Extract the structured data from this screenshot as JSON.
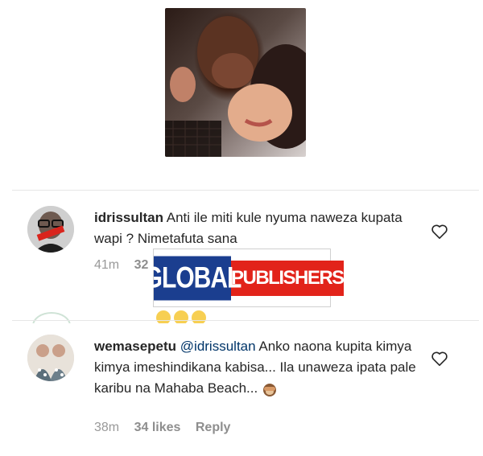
{
  "post": {
    "image": "post-photo-couple"
  },
  "comments": [
    {
      "username": "idrissultan",
      "text": "Anti ile miti kule nyuma naweza kupata wapi ? Nimetafuta sana",
      "time": "41m",
      "likes": "32",
      "avatar_badge": "ORDERED"
    },
    {
      "username": "wemasepetu",
      "mention": "@idrissultan",
      "text": "Anko naona kupita kimya kimya imeshindikana kabisa... Ila unaweza ipata pale karibu na Mahaba Beach...",
      "time": "38m",
      "likes": "34 likes",
      "reply": "Reply"
    }
  ],
  "watermark": {
    "left": "GLOBAL",
    "right": "PUBLISHERS"
  },
  "icons": [
    "heart-icon",
    "monkey-emoji-icon"
  ],
  "colors": {
    "text": "#262626",
    "meta": "#999999",
    "mention": "#003569",
    "watermark_blue": "#1b3e8f",
    "watermark_red": "#e2231a"
  }
}
